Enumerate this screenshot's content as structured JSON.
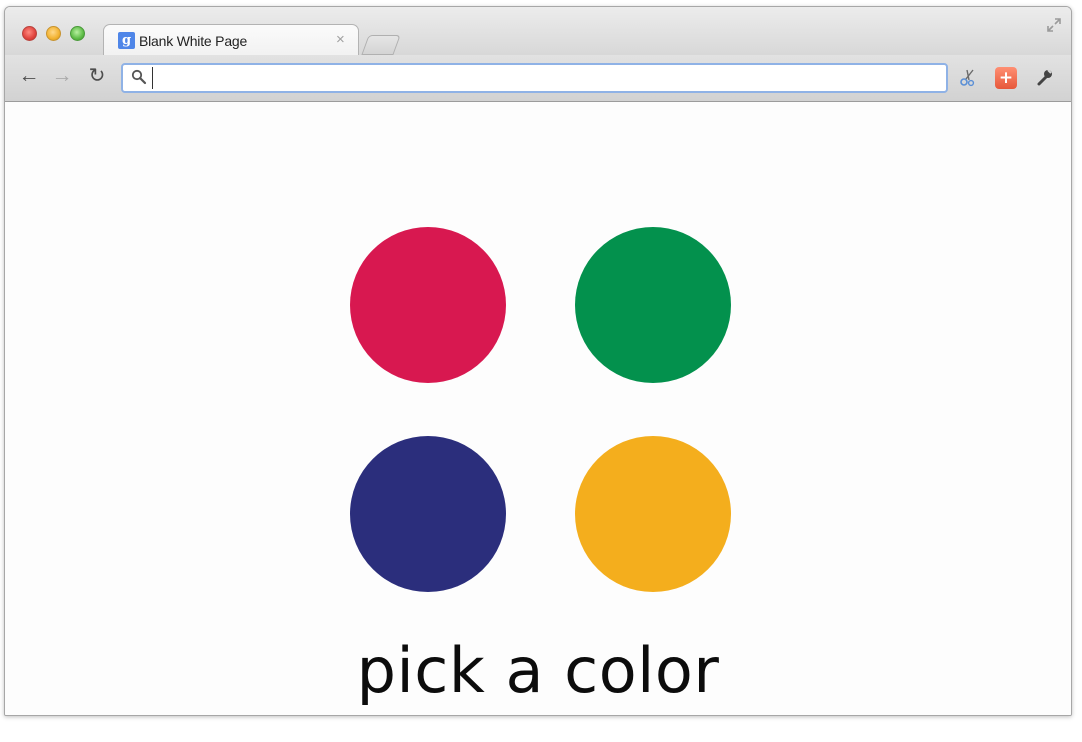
{
  "tab": {
    "title": "Blank White Page",
    "favicon_letter": "g",
    "close_glyph": "×"
  },
  "toolbar": {
    "back_glyph": "←",
    "forward_glyph": "→",
    "reload_glyph": "↻",
    "omnibox_value": "",
    "extension_plus": "+"
  },
  "content": {
    "prompt": "pick a color",
    "colors": [
      "#d81850",
      "#03914d",
      "#2b2e7c",
      "#f4ae1d"
    ],
    "color_names": [
      "red",
      "green",
      "blue",
      "yellow"
    ]
  }
}
